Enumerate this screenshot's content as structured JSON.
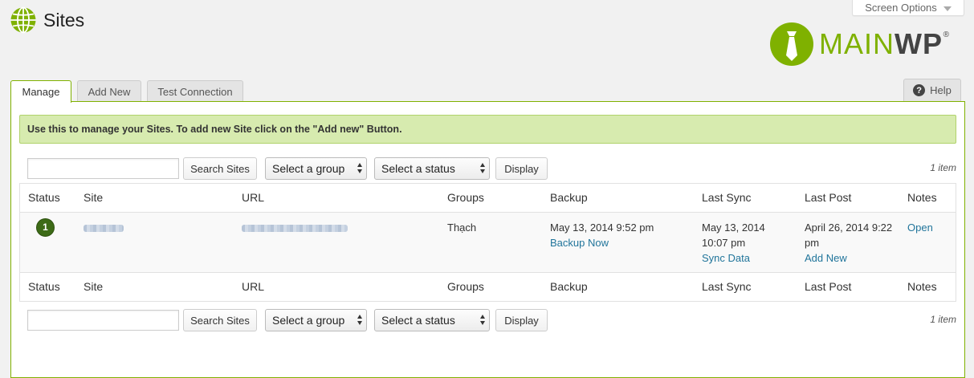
{
  "header": {
    "title": "Sites",
    "screen_options": "Screen Options",
    "logo_main": "MAIN",
    "logo_wp": "WP",
    "logo_reg": "®",
    "icon": "globe-icon"
  },
  "tabs": [
    {
      "label": "Manage",
      "active": true
    },
    {
      "label": "Add New",
      "active": false
    },
    {
      "label": "Test Connection",
      "active": false
    }
  ],
  "help": {
    "label": "Help",
    "icon": "question-icon"
  },
  "notice": "Use this to manage your Sites. To add new Site click on the \"Add new\" Button.",
  "controls": {
    "search_value": "",
    "search_button": "Search Sites",
    "group_select": "Select a group",
    "status_select": "Select a status",
    "display_button": "Display",
    "count": "1 item"
  },
  "columns": [
    "Status",
    "Site",
    "URL",
    "Groups",
    "Backup",
    "Last Sync",
    "Last Post",
    "Notes"
  ],
  "rows": [
    {
      "status": "1",
      "site": "",
      "url": "",
      "groups": "Thạch",
      "backup_date": "May 13, 2014 9:52 pm",
      "backup_action": "Backup Now",
      "last_sync_date": "May 13, 2014 10:07 pm",
      "sync_action": "Sync Data",
      "last_post_date": "April 26, 2014 9:22 pm",
      "post_action": "Add New",
      "notes": "Open"
    }
  ],
  "colors": {
    "accent": "#7fb100",
    "notice_bg": "#d7ebaf",
    "link": "#21759b",
    "badge": "#3d6b17"
  }
}
